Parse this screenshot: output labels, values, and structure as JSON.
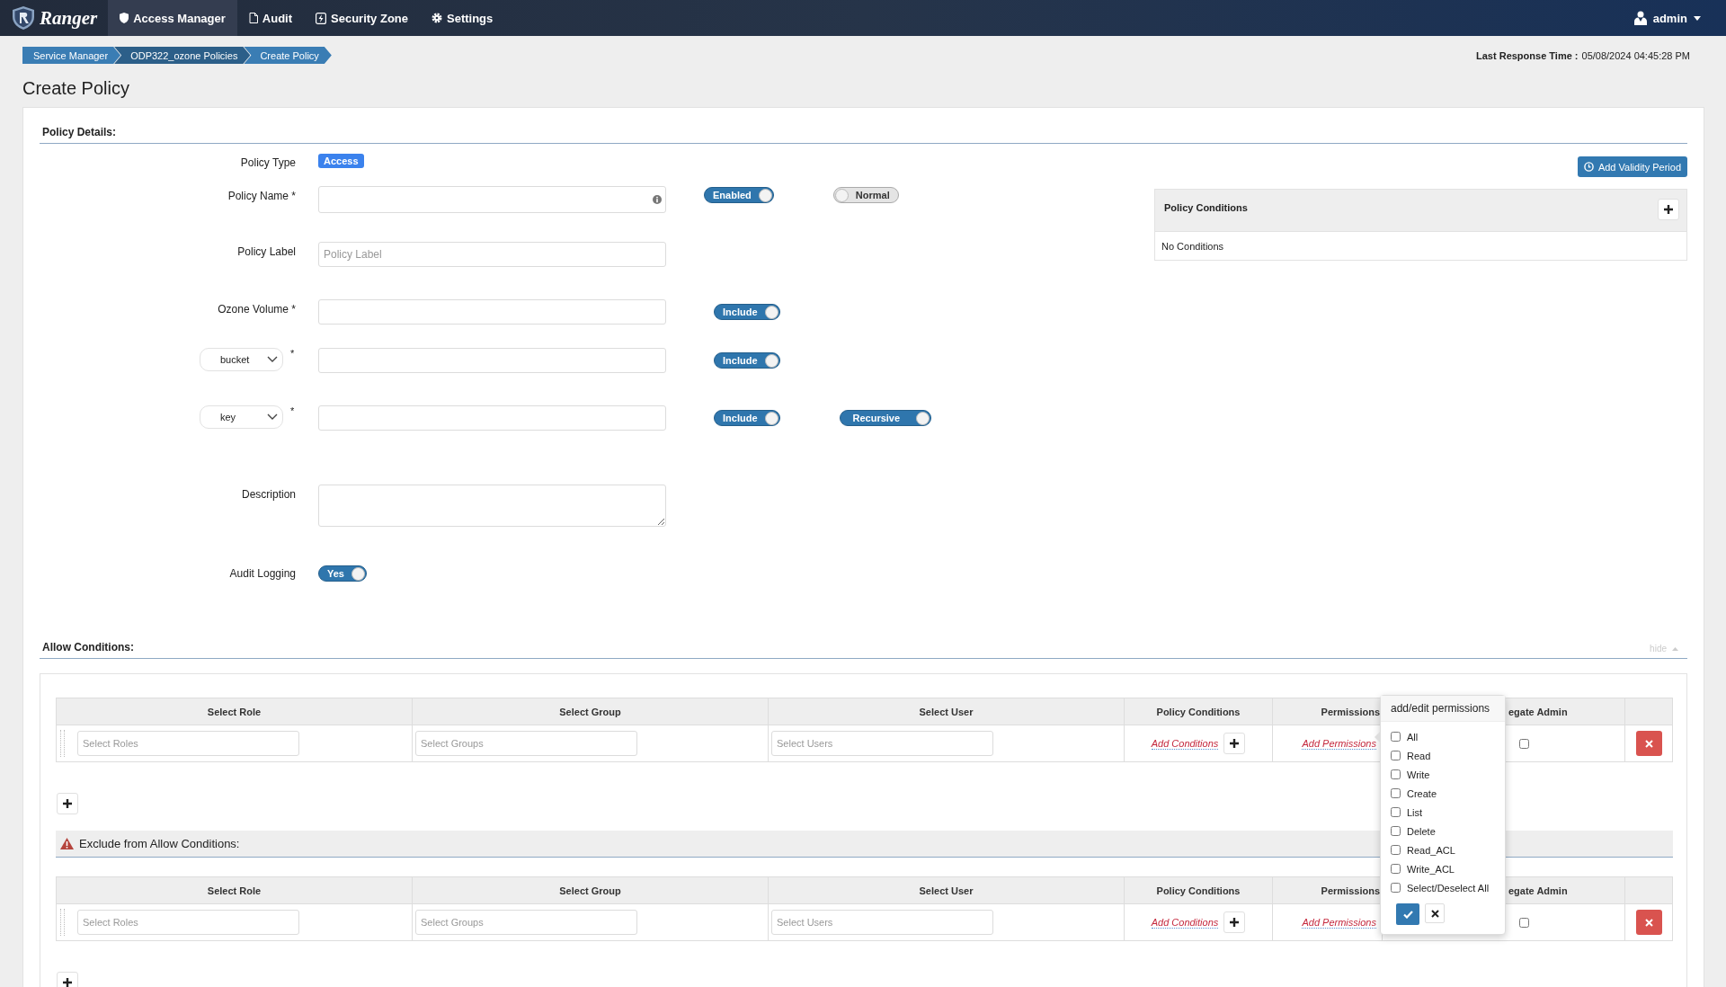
{
  "nav": {
    "logo": "Ranger",
    "items": [
      {
        "label": "Access Manager",
        "selected": true
      },
      {
        "label": "Audit",
        "selected": false
      },
      {
        "label": "Security Zone",
        "selected": false
      },
      {
        "label": "Settings",
        "selected": false
      }
    ],
    "user": "admin"
  },
  "breadcrumb": [
    "Service Manager",
    "ODP322_ozone Policies",
    "Create Policy"
  ],
  "last_response": {
    "label": "Last Response Time :",
    "value": "05/08/2024 04:45:28 PM"
  },
  "title": "Create Policy",
  "policy_details": {
    "heading": "Policy Details:",
    "policy_type": {
      "label": "Policy Type",
      "badge": "Access"
    },
    "policy_name": {
      "label": "Policy Name *",
      "toggles": [
        {
          "label": "Enabled",
          "on": true
        },
        {
          "label": "Normal",
          "on": false
        }
      ]
    },
    "policy_label": {
      "label": "Policy Label",
      "placeholder": "Policy Label"
    },
    "resources": [
      {
        "kind": "label",
        "label": "Ozone Volume *",
        "toggles": [
          {
            "label": "Include",
            "on": true
          }
        ]
      },
      {
        "kind": "select",
        "value": "bucket",
        "required": "*",
        "toggles": [
          {
            "label": "Include",
            "on": true
          }
        ]
      },
      {
        "kind": "select",
        "value": "key",
        "required": "*",
        "toggles": [
          {
            "label": "Include",
            "on": true
          },
          {
            "label": "Recursive",
            "on": true
          }
        ]
      }
    ],
    "description": {
      "label": "Description"
    },
    "audit_logging": {
      "label": "Audit Logging",
      "toggle": {
        "label": "Yes",
        "on": true
      }
    },
    "validity_button": "Add Validity Period",
    "policy_conditions": {
      "title": "Policy Conditions",
      "empty": "No Conditions"
    }
  },
  "allow_conditions": {
    "heading": "Allow Conditions:",
    "hide": "hide",
    "columns": [
      "Select Role",
      "Select Group",
      "Select User",
      "Policy Conditions",
      "Permissions",
      "egate Admin"
    ],
    "rows": [
      {
        "role_placeholder": "Select Roles",
        "group_placeholder": "Select Groups",
        "user_placeholder": "Select Users",
        "conditions_link": "Add Conditions",
        "permissions_link": "Add Permissions",
        "delegate_admin": false
      }
    ]
  },
  "exclude_conditions": {
    "heading": "Exclude from Allow Conditions:",
    "columns": [
      "Select Role",
      "Select Group",
      "Select User",
      "Policy Conditions",
      "Permissions",
      "egate Admin"
    ],
    "rows": [
      {
        "role_placeholder": "Select Roles",
        "group_placeholder": "Select Groups",
        "user_placeholder": "Select Users",
        "conditions_link": "Add Conditions",
        "permissions_link": "Add Permissions",
        "delegate_admin": false
      }
    ]
  },
  "permissions_popover": {
    "title": "add/edit permissions",
    "options": [
      {
        "label": "All",
        "checked": false
      },
      {
        "label": "Read",
        "checked": false
      },
      {
        "label": "Write",
        "checked": false
      },
      {
        "label": "Create",
        "checked": false
      },
      {
        "label": "List",
        "checked": false
      },
      {
        "label": "Delete",
        "checked": false
      },
      {
        "label": "Read_ACL",
        "checked": false
      },
      {
        "label": "Write_ACL",
        "checked": false
      },
      {
        "label": "Select/Deselect All",
        "checked": false
      }
    ]
  }
}
